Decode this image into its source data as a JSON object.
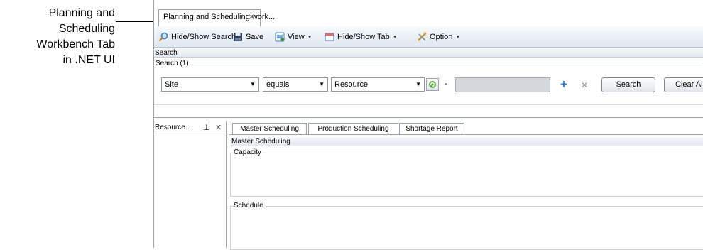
{
  "callout": {
    "line1": "Planning and",
    "line2": "Scheduling",
    "line3": "Workbench Tab",
    "line4": "in .NET UI"
  },
  "tab": {
    "label": "Planning and Scheduling work...",
    "close": "✕"
  },
  "toolbar": {
    "hide_show_search": "Hide/Show Search",
    "save": "Save",
    "view": "View",
    "hide_show_tab": "Hide/Show Tab",
    "option": "Option"
  },
  "search": {
    "section_title": "Search",
    "group_label": "Search (1)",
    "field": "Site",
    "operator": "equals",
    "value_type": "Resource",
    "dash": "-",
    "search_button": "Search",
    "clear_button": "Clear Al"
  },
  "left_panel": {
    "title": "Resource...",
    "pin": "⊥",
    "close": "✕"
  },
  "inner_tabs": [
    "Master Scheduling",
    "Production Scheduling",
    "Shortage Report"
  ],
  "master": {
    "section_title": "Master Scheduling",
    "capacity_label": "Capacity",
    "schedule_label": "Schedule"
  }
}
